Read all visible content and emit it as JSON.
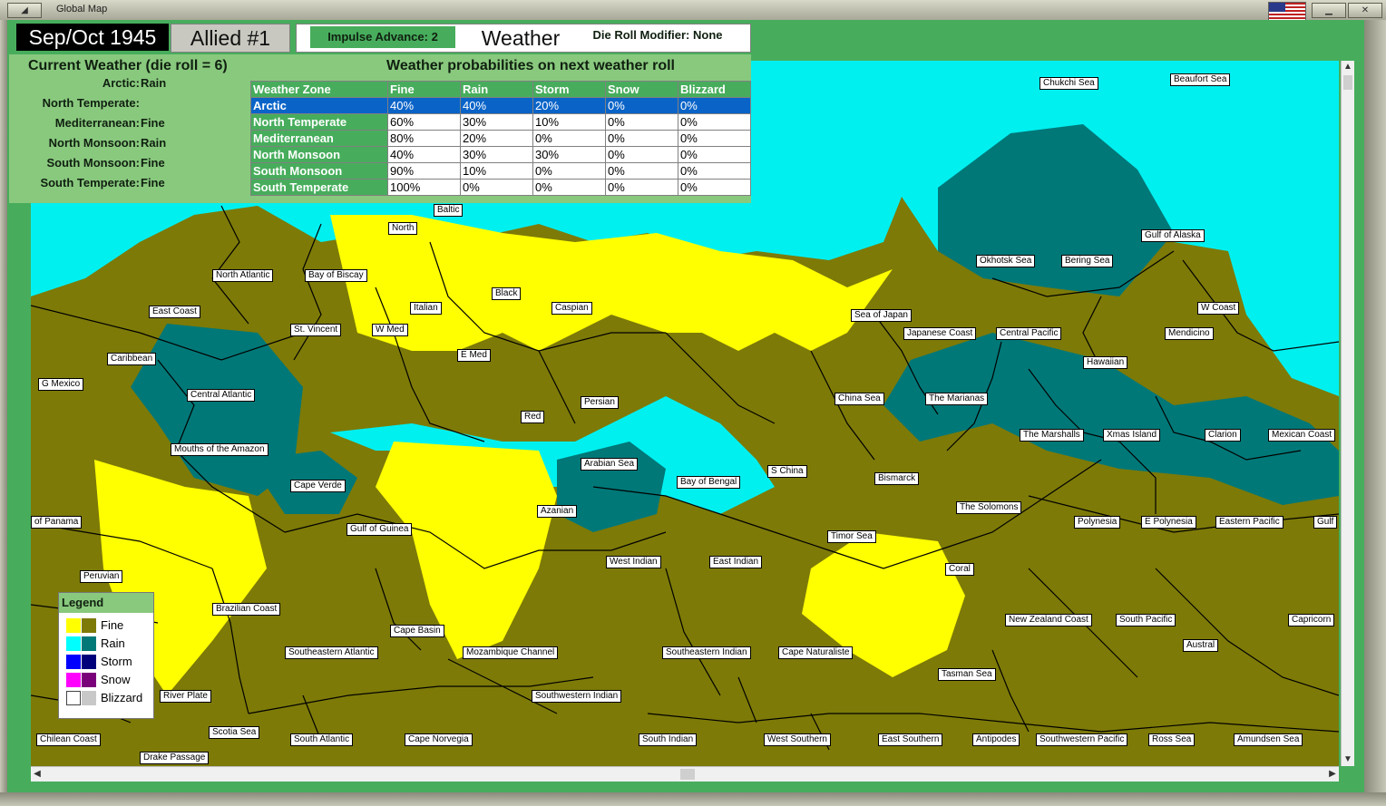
{
  "window": {
    "title": "Global Map"
  },
  "header": {
    "date": "Sep/Oct 1945",
    "side": "Allied #1",
    "impulse_advance": "Impulse Advance:  2",
    "tab_title": "Weather",
    "die_roll_modifier": "Die Roll Modifier:  None"
  },
  "current_weather": {
    "title": "Current Weather (die roll = 6)",
    "zones": [
      {
        "name": "Arctic:",
        "value": "Rain"
      },
      {
        "name": "North Temperate:",
        "value": ""
      },
      {
        "name": "Mediterranean:",
        "value": "Fine"
      },
      {
        "name": "North Monsoon:",
        "value": "Rain"
      },
      {
        "name": "South Monsoon:",
        "value": "Fine"
      },
      {
        "name": "South Temperate:",
        "value": "Fine"
      }
    ]
  },
  "probabilities": {
    "title": "Weather probabilities on next weather roll",
    "headers": [
      "Weather Zone",
      "Fine",
      "Rain",
      "Storm",
      "Snow",
      "Blizzard"
    ],
    "rows": [
      [
        "Arctic",
        "40%",
        "40%",
        "20%",
        "0%",
        "0%"
      ],
      [
        "North Temperate",
        "60%",
        "30%",
        "10%",
        "0%",
        "0%"
      ],
      [
        "Mediterranean",
        "80%",
        "20%",
        "0%",
        "0%",
        "0%"
      ],
      [
        "North Monsoon",
        "40%",
        "30%",
        "30%",
        "0%",
        "0%"
      ],
      [
        "South Monsoon",
        "90%",
        "10%",
        "0%",
        "0%",
        "0%"
      ],
      [
        "South Temperate",
        "100%",
        "0%",
        "0%",
        "0%",
        "0%"
      ]
    ],
    "selected_row": "Arctic"
  },
  "legend": {
    "title": "Legend",
    "items": [
      {
        "label": "Fine",
        "colors": [
          "#ffff00",
          "#7d7a08"
        ]
      },
      {
        "label": "Rain",
        "colors": [
          "#00ffff",
          "#007878"
        ]
      },
      {
        "label": "Storm",
        "colors": [
          "#0000ff",
          "#00007a"
        ]
      },
      {
        "label": "Snow",
        "colors": [
          "#ff00ff",
          "#7a007a"
        ]
      },
      {
        "label": "Blizzard",
        "colors": [
          "#ffffff",
          "#c8c8c8"
        ]
      }
    ]
  },
  "sea_areas": {
    "chukchi": "Chukchi Sea",
    "beaufort": "Beaufort Sea",
    "baltic": "Baltic",
    "north": "North",
    "gulf_alaska": "Gulf of Alaska",
    "north_atlantic": "North Atlantic",
    "bay_biscay": "Bay of Biscay",
    "okhotsk": "Okhotsk Sea",
    "bering": "Bering Sea",
    "black": "Black",
    "italian": "Italian",
    "caspian": "Caspian",
    "w_coast": "W Coast",
    "east_coast": "East Coast",
    "sea_japan": "Sea of Japan",
    "st_vincent": "St. Vincent",
    "w_med": "W Med",
    "japanese_coast": "Japanese Coast",
    "central_pacific": "Central Pacific",
    "mendicino": "Mendicino",
    "e_med": "E Med",
    "caribbean": "Caribbean",
    "hawaiian": "Hawaiian",
    "g_mexico": "G Mexico",
    "central_atlantic": "Central Atlantic",
    "china_sea": "China Sea",
    "the_marianas": "The Marianas",
    "persian": "Persian",
    "red": "Red",
    "the_marshalls": "The Marshalls",
    "xmas_island": "Xmas Island",
    "clarion": "Clarion",
    "mexican_coast": "Mexican Coast",
    "mouths_amazon": "Mouths of the Amazon",
    "arabian_sea": "Arabian Sea",
    "s_china": "S China",
    "bismarck": "Bismarck",
    "bay_bengal": "Bay of Bengal",
    "cape_verde": "Cape Verde",
    "the_solomons": "The Solomons",
    "azanian": "Azanian",
    "of_panama": "of Panama",
    "polynesia": "Polynesia",
    "e_polynesia": "E Polynesia",
    "eastern_pacific": "Eastern Pacific",
    "gulf_edge": "Gulf",
    "gulf_guinea": "Gulf of Guinea",
    "timor_sea": "Timor Sea",
    "west_indian": "West Indian",
    "east_indian": "East Indian",
    "peruvian": "Peruvian",
    "coral": "Coral",
    "brazilian_coast": "Brazilian Coast",
    "new_zealand_coast": "New Zealand Coast",
    "south_pacific": "South Pacific",
    "capricorn": "Capricorn",
    "cape_basin": "Cape Basin",
    "austral": "Austral",
    "southeastern_atlantic": "Southeastern Atlantic",
    "mozambique_channel": "Mozambique Channel",
    "southeastern_indian": "Southeastern Indian",
    "cape_naturaliste": "Cape Naturaliste",
    "tasman_sea": "Tasman Sea",
    "river_plate": "River Plate",
    "southwestern_indian": "Southwestern Indian",
    "scotia_sea": "Scotia Sea",
    "chilean_coast": "Chilean Coast",
    "south_atlantic": "South Atlantic",
    "cape_norvegia": "Cape Norvegia",
    "south_indian": "South Indian",
    "west_southern": "West Southern",
    "east_southern": "East Southern",
    "antipodes": "Antipodes",
    "southwestern_pacific": "Southwestern Pacific",
    "ross_sea": "Ross Sea",
    "amundsen_sea": "Amundsen Sea",
    "drake_passage": "Drake Passage"
  }
}
